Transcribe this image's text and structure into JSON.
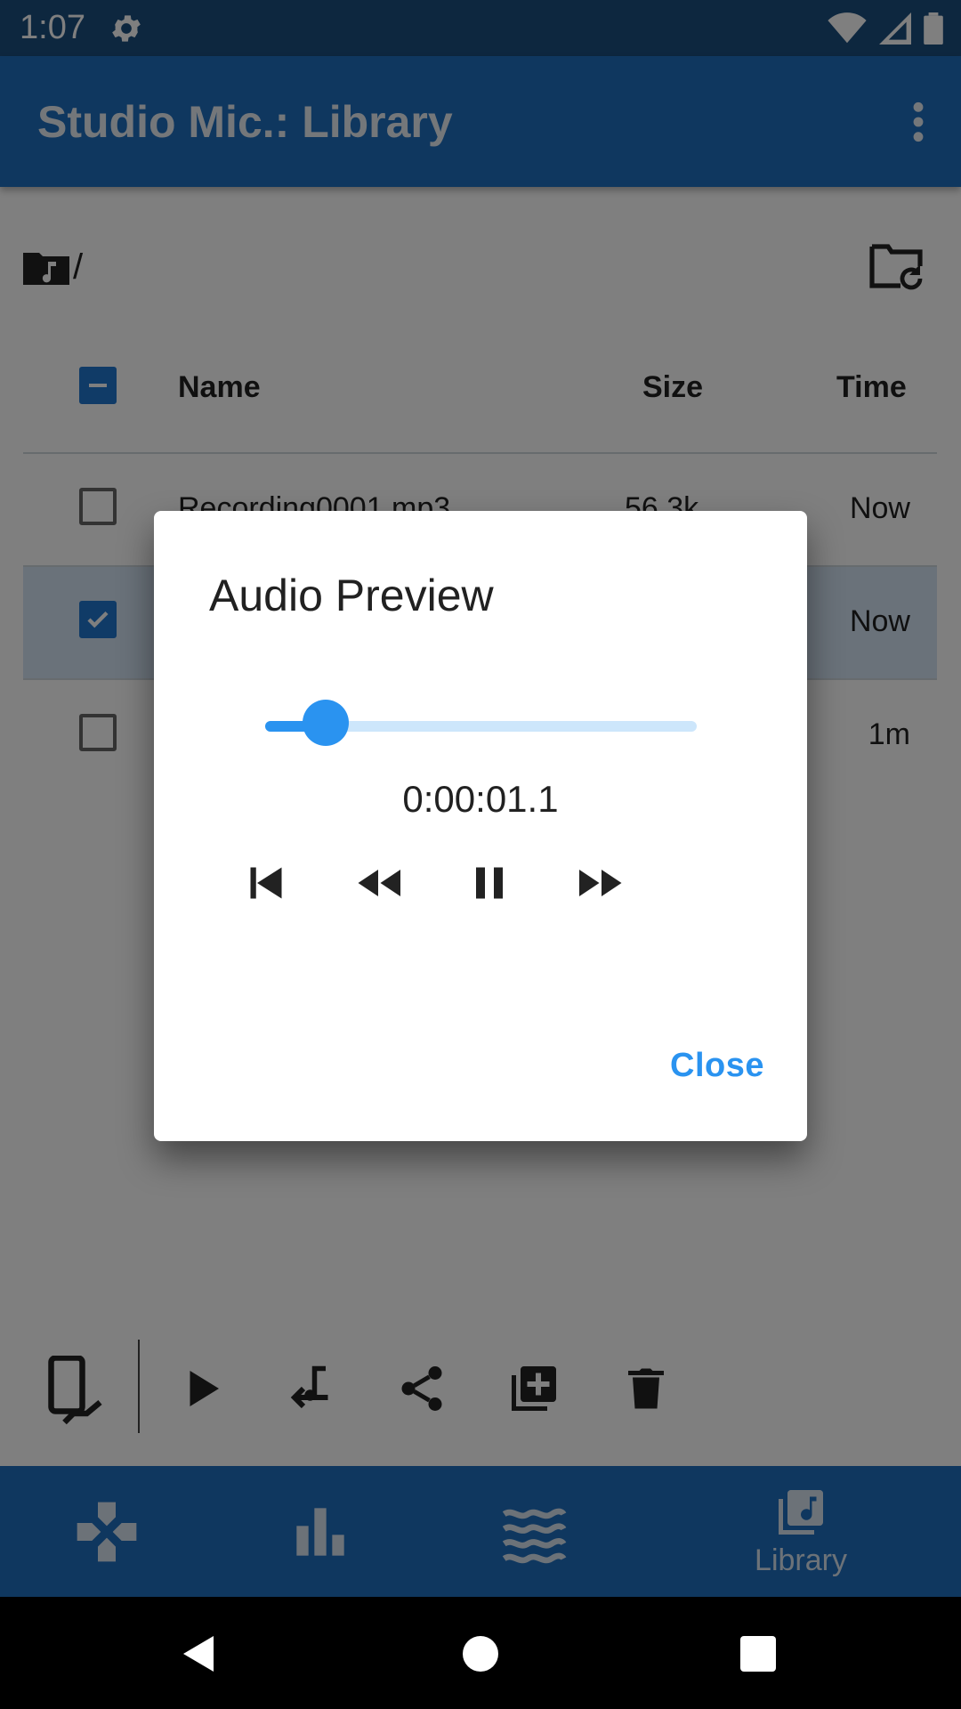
{
  "status_bar": {
    "time": "1:07"
  },
  "app_bar": {
    "title": "Studio Mic.: Library"
  },
  "path": {
    "text": "/"
  },
  "table": {
    "headers": {
      "name": "Name",
      "size": "Size",
      "time": "Time"
    },
    "rows": [
      {
        "name": "Recording0001.mp3",
        "size": "56.3k",
        "time": "Now",
        "checked": false
      },
      {
        "name": "",
        "size": "",
        "time": "Now",
        "checked": true
      },
      {
        "name": "",
        "size": "",
        "time": "1m",
        "checked": false
      }
    ]
  },
  "bottom_nav": {
    "items": [
      {
        "icon": "gamepad-icon",
        "label": ""
      },
      {
        "icon": "bar-chart-icon",
        "label": ""
      },
      {
        "icon": "waves-icon",
        "label": ""
      },
      {
        "icon": "library-music-icon",
        "label": "Library"
      }
    ]
  },
  "dialog": {
    "title": "Audio Preview",
    "position_text": "0:00:01.1",
    "progress_fraction": 0.14,
    "close_label": "Close"
  },
  "colors": {
    "primary": "#1f6fbf",
    "status_bar": "#1b4e7f",
    "accent": "#2a93f0",
    "selected_row": "#d4e4f5"
  }
}
